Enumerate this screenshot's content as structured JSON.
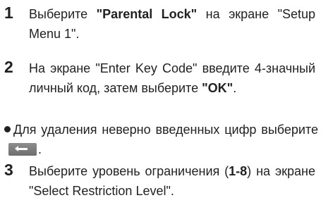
{
  "step1": {
    "number": "1",
    "pre": "Выберите ",
    "bold": "\"Parental Lock\"",
    "post": " на экране \"Setup Menu 1\"."
  },
  "step2": {
    "number": "2",
    "pre": "На экране \"Enter Key Code\" введите 4-значный личный код, затем выберите ",
    "bold": "\"OK\"",
    "post": "."
  },
  "note": {
    "text": "Для удаления неверно введенных цифр выберите",
    "end": ".",
    "button_icon": "back-arrow-icon"
  },
  "step3": {
    "number": "3",
    "pre": "Выберите уровень ограничения (",
    "bold": "1-8",
    "post": ") на экране \"Select Restriction Level\"."
  }
}
